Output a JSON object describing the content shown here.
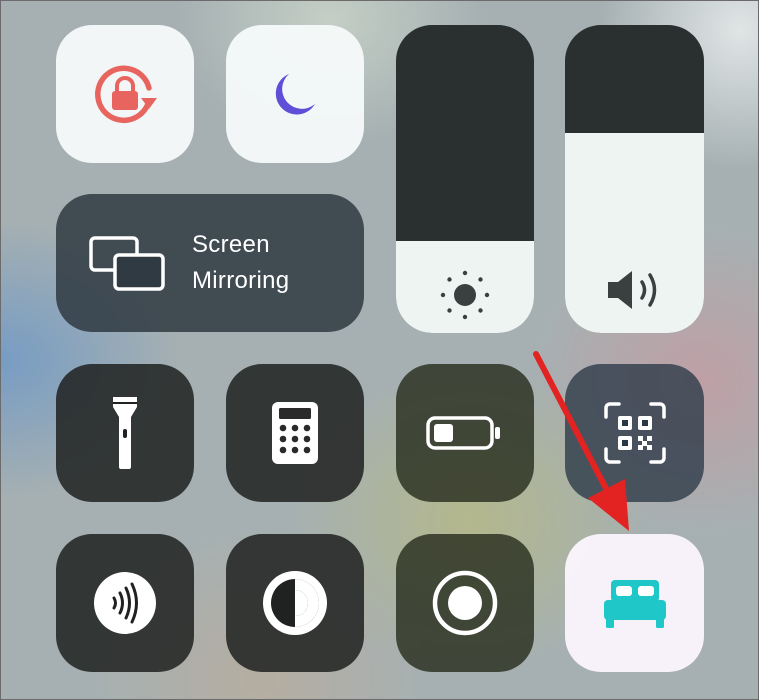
{
  "screen_mirroring": {
    "line1": "Screen",
    "line2": "Mirroring"
  },
  "sliders": {
    "brightness_level": 0.3,
    "volume_level": 0.65
  },
  "icons": {
    "rotation_lock": "rotation-lock-icon",
    "do_not_disturb": "moon-icon",
    "screen_mirroring": "screen-mirroring-icon",
    "brightness": "sun-icon",
    "volume": "speaker-icon",
    "flashlight": "flashlight-icon",
    "calculator": "calculator-icon",
    "low_power": "battery-icon",
    "code_scanner": "qr-code-icon",
    "nfc": "nfc-icon",
    "dark_mode": "dark-mode-icon",
    "screen_recording": "record-icon",
    "sleep": "bed-icon"
  },
  "colors": {
    "rotation_lock": "#e8655f",
    "moon": "#5f4fd8",
    "sleep": "#1fc7c8",
    "annotation_arrow": "#e32222"
  }
}
